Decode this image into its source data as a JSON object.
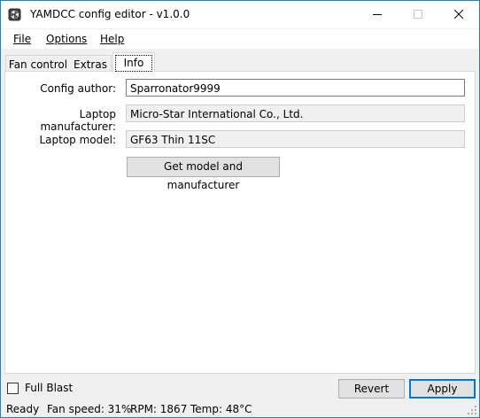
{
  "window": {
    "title": "YAMDCC config editor - v1.0.0",
    "app_icon": "fan-icon",
    "controls": [
      "minimize-icon",
      "maximize-icon",
      "close-icon"
    ]
  },
  "menu": {
    "items": [
      {
        "label": "File"
      },
      {
        "label": "Options"
      },
      {
        "label": "Help"
      }
    ]
  },
  "tabs": [
    {
      "label": "Fan control"
    },
    {
      "label": "Extras"
    },
    {
      "label": "Info",
      "selected": true
    }
  ],
  "info": {
    "author_label": "Config author:",
    "author_value": "Sparronator9999",
    "manufacturer_label": "Laptop manufacturer:",
    "manufacturer_value": "Micro-Star International Co., Ltd.",
    "model_label": "Laptop model:",
    "model_value": "GF63 Thin 11SC",
    "get_button": "Get model and manufacturer"
  },
  "bottom": {
    "full_blast_label": "Full Blast",
    "full_blast_checked": false,
    "revert_button": "Revert",
    "apply_button": "Apply"
  },
  "status": {
    "ready": "Ready",
    "fan_speed": "Fan speed: 31%",
    "rpm": "RPM: 1867",
    "temp": "Temp: 48°C"
  },
  "colors": {
    "accent": "#0078d7",
    "window_border": "#1883d7",
    "background": "#f0f0f0"
  }
}
